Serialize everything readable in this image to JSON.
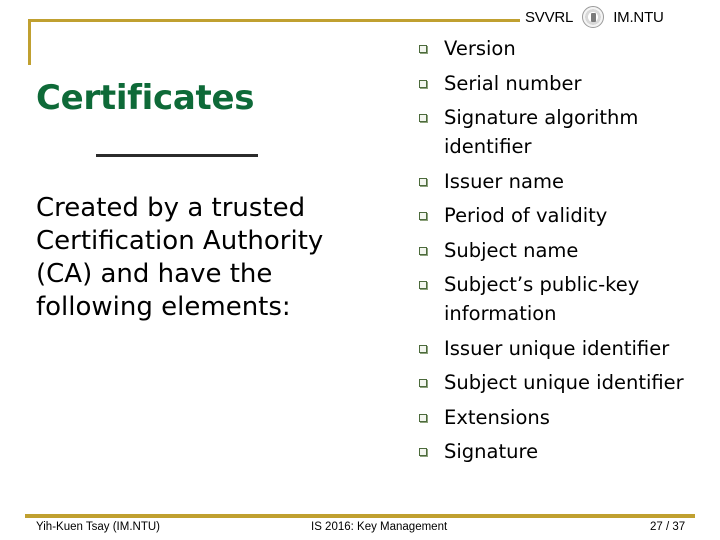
{
  "header": {
    "brand_left": "SVVRL",
    "brand_right": "IM.NTU",
    "logo_icon": "university-seal-icon"
  },
  "slide": {
    "title": "Certificates",
    "intro": "Created by a trusted Certification Authority (CA) and have the following elements:",
    "bullet_icon": "square-bullet-icon",
    "elements": [
      "Version",
      "Serial number",
      "Signature algorithm identifier",
      "Issuer name",
      "Period of validity",
      "Subject name",
      "Subject’s public-key information",
      "Issuer unique identifier",
      "Subject unique identifier",
      "Extensions",
      "Signature"
    ]
  },
  "footer": {
    "author": "Yih-Kuen Tsay (IM.NTU)",
    "course": "IS 2016: Key Management",
    "page": "27 / 37"
  },
  "colors": {
    "frame_gold": "#c0a030",
    "title_green": "#0e6a38",
    "bullet_green": "#4c6a3c"
  }
}
